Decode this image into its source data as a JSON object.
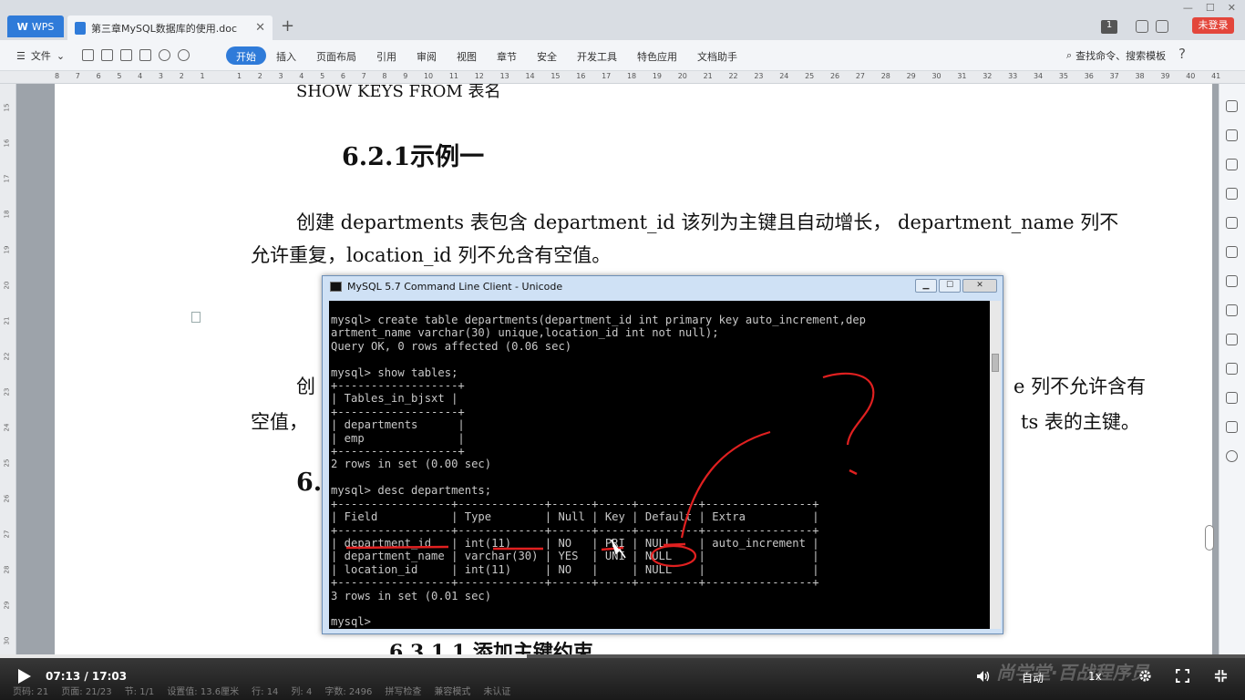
{
  "titlebar": {
    "wps_tab": "WPS",
    "doc_tab": "第三章MySQL数据库的使用.doc",
    "page_count": "1",
    "login": "未登录"
  },
  "ribbon": {
    "file": "文件",
    "menus": [
      "开始",
      "插入",
      "页面布局",
      "引用",
      "审阅",
      "视图",
      "章节",
      "安全",
      "开发工具",
      "特色应用",
      "文档助手"
    ],
    "active_menu": "开始",
    "search": "查找命令、搜索模板"
  },
  "ruler": {
    "ticks": [
      "8",
      "7",
      "6",
      "5",
      "4",
      "3",
      "2",
      "1",
      "",
      "1",
      "2",
      "3",
      "4",
      "5",
      "6",
      "7",
      "8",
      "9",
      "10",
      "11",
      "12",
      "13",
      "14",
      "15",
      "16",
      "17",
      "18",
      "19",
      "20",
      "21",
      "22",
      "23",
      "24",
      "25",
      "26",
      "27",
      "28",
      "29",
      "30",
      "31",
      "32",
      "33",
      "34",
      "35",
      "36",
      "37",
      "38",
      "39",
      "40",
      "41"
    ]
  },
  "vruler": [
    "15",
    "16",
    "17",
    "18",
    "19",
    "20",
    "21",
    "22",
    "23",
    "24",
    "25",
    "26",
    "27",
    "28",
    "29",
    "30"
  ],
  "document": {
    "cut_top": "SHOW KEYS FROM 表名",
    "heading_621": "6.2.1示例一",
    "para1_line1": "创建 departments 表包含 department_id 该列为主键且自动增长， department_name 列不",
    "para1_line2": "允许重复，location_id 列不允含有空值。",
    "para2_line1_left": "创",
    "para2_line1_right": "e 列不允许含有",
    "para2_line2_left": "空值，",
    "para2_line2_right": "ts 表的主键。",
    "heading_6_trunc": "6.",
    "heading_6311": "6.3.1.1  添加主键约束"
  },
  "mysql": {
    "title": "MySQL 5.7 Command Line Client - Unicode",
    "lines": [
      "mysql> create table departments(department_id int primary key auto_increment,dep",
      "artment_name varchar(30) unique,location_id int not null);",
      "Query OK, 0 rows affected (0.06 sec)",
      "",
      "mysql> show tables;",
      "+------------------+",
      "| Tables_in_bjsxt |",
      "+------------------+",
      "| departments      |",
      "| emp              |",
      "+------------------+",
      "2 rows in set (0.00 sec)",
      "",
      "mysql> desc departments;",
      "+-----------------+-------------+------+-----+---------+----------------+",
      "| Field           | Type        | Null | Key | Default | Extra          |",
      "+-----------------+-------------+------+-----+---------+----------------+",
      "| department_id   | int(11)     | NO   | PRI | NULL    | auto_increment |",
      "| department_name | varchar(30) | YES  | UNI | NULL    |                |",
      "| location_id     | int(11)     | NO   |     | NULL    |                |",
      "+-----------------+-------------+------+-----+---------+----------------+",
      "3 rows in set (0.01 sec)",
      "",
      "mysql>"
    ]
  },
  "player": {
    "time": "07:13 / 17:03",
    "progress_fraction": 0.423,
    "auto": "自动",
    "speed": "1x",
    "watermark": "尚学堂·百战程序员",
    "status": [
      "页码: 21",
      "页面: 21/23",
      "节: 1/1",
      "设置值: 13.6厘米",
      "行: 14",
      "列: 4",
      "字数: 2496",
      "拼写检查",
      "兼容模式",
      "未认证"
    ]
  }
}
